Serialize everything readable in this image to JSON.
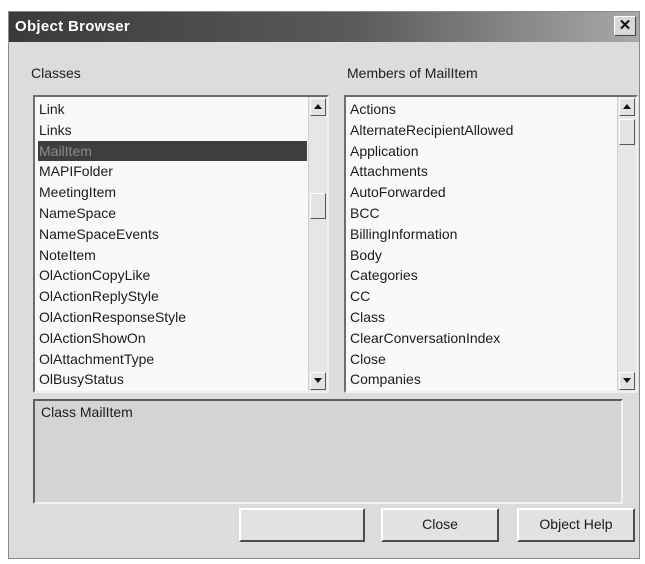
{
  "window": {
    "title": "Object Browser",
    "close_glyph": "✕"
  },
  "classes": {
    "label": "Classes",
    "items": [
      "Link",
      "Links",
      "MailItem",
      "MAPIFolder",
      "MeetingItem",
      "NameSpace",
      "NameSpaceEvents",
      "NoteItem",
      "OlActionCopyLike",
      "OlActionReplyStyle",
      "OlActionResponseStyle",
      "OlActionShowOn",
      "OlAttachmentType",
      "OlBusyStatus"
    ],
    "selected": "MailItem"
  },
  "members": {
    "label": "Members of MailItem",
    "items": [
      "Actions",
      "AlternateRecipientAllowed",
      "Application",
      "Attachments",
      "AutoForwarded",
      "BCC",
      "BillingInformation",
      "Body",
      "Categories",
      "CC",
      "Class",
      "ClearConversationIndex",
      "Close",
      "Companies"
    ]
  },
  "description": {
    "text": "Class MailItem"
  },
  "buttons": {
    "blank_label": "",
    "close_label": "Close",
    "help_label": "Object Help"
  },
  "colors": {
    "titlebar": "#3a3a3a",
    "selection": "#3e3e3e",
    "dialog_bg": "#dcdcdc"
  }
}
